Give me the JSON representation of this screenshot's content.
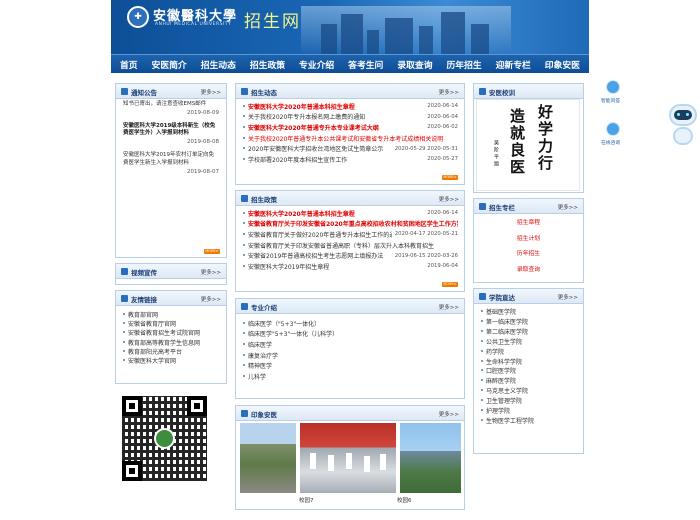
{
  "header": {
    "university_name": "安徽醫科大學",
    "university_en": "ANHUI MEDICAL UNIVERSITY",
    "site_title": "招生网"
  },
  "nav": {
    "items": [
      "首页",
      "安医简介",
      "招生动态",
      "招生政策",
      "专业介绍",
      "答考生问",
      "录取查询",
      "历年招生",
      "迎新专栏",
      "印象安医"
    ]
  },
  "notice": {
    "title": "通知公告",
    "more": "更多>>",
    "items": [
      {
        "text": "安徽医科大学2019年普通高考录取通知书已寄出，请注意查收EMS邮件",
        "date": "2019-08-09"
      },
      {
        "text": "安徽医科大学2019级本科新生（校免费医学生外）入学报到材料",
        "date": "2019-08-08"
      },
      {
        "text": "安徽医科大学2019年农村订单定向免费医学生新生入学报到材料",
        "date": "2019-08-07"
      }
    ],
    "more_tag": "MORE>"
  },
  "video": {
    "title": "视频宣传",
    "more": "更多>>"
  },
  "links": {
    "title": "友情链接",
    "more": "更多>>",
    "items": [
      "教育部官网",
      "安徽省教育厅官网",
      "安徽省教育招生考试院官网",
      "教育部高等教育学生信息网",
      "教育部阳光高考平台",
      "安徽医科大学官网"
    ]
  },
  "dynamics": {
    "title": "招生动态",
    "more": "更多>>",
    "rows": [
      {
        "text": "安徽医科大学2020年普通本科招生章程",
        "date": "2020-06-14",
        "style": "red bold"
      },
      {
        "text": "关于我校2020年专升本报名网上缴费的通知",
        "date": "2020-06-04",
        "style": ""
      },
      {
        "text": "安徽医科大学2020年普通专升本专业课考试大纲",
        "date": "2020-06-02",
        "style": "red bold"
      },
      {
        "text": "关于我校2020年普通专升本公共课考试和安徽省专升本考试成绩相关说明",
        "date": "",
        "style": "red"
      },
      {
        "text": "2020年安徽医科大学招收台湾地区免试生简章公示",
        "date": "2020-05-29  2020-05-31",
        "style": ""
      },
      {
        "text": "学校部署2020年度本科招生宣传工作",
        "date": "2020-05-27",
        "style": ""
      }
    ],
    "more_tag": "MORE>"
  },
  "policy": {
    "title": "招生政策",
    "more": "更多>>",
    "rows": [
      {
        "text": "安徽医科大学2020年普通本科招生章程",
        "date": "2020-06-14",
        "style": "red bold"
      },
      {
        "text": "安徽省教育厅关于印发安徽省2020年重点高校招收农村和贫困地区学生工作方案的通知",
        "date": "",
        "style": "red bold"
      },
      {
        "text": "安徽省教育厅关于做好2020年普通专升本招生工作的通知",
        "date": "2020-04-17  2020-05-21",
        "style": ""
      },
      {
        "text": "安徽省教育厅关于印发安徽省普通高职（专科）层次升入本科教育招生",
        "date": "",
        "style": ""
      },
      {
        "text": "安徽省2019年普通高校招生考生志愿网上填报办法",
        "date": "2019-06-15  2020-03-26",
        "style": ""
      },
      {
        "text": "安徽医科大学2019年招生章程",
        "date": "2019-06-04",
        "style": ""
      }
    ],
    "more_tag": "MORE>"
  },
  "majors": {
    "title": "专业介绍",
    "more": "更多>>",
    "items": [
      "临床医学（\"5+3\"一体化）",
      "临床医学\"5+3\"一体化（儿科学）",
      "临床医学",
      "康复治疗学",
      "精神医学",
      "儿科学"
    ]
  },
  "impression": {
    "title": "印象安医",
    "more": "更多>>",
    "captions": [
      "校园7",
      "校园6"
    ]
  },
  "campus": {
    "title": "安医校训",
    "calligraphy_cols": [
      "好学力行",
      "造就良医"
    ],
    "signature": "吴阶平题"
  },
  "zhuanlan": {
    "title": "招生专栏",
    "more": "更多>>",
    "items": [
      "招生章程",
      "招生计划",
      "历年招生",
      "录取查询"
    ]
  },
  "colleges": {
    "title": "学院直达",
    "more": "更多>>",
    "items": [
      "基础医学院",
      "第一临床医学院",
      "第二临床医学院",
      "公共卫生学院",
      "药学院",
      "生命科学学院",
      "口腔医学院",
      "麻醉医学院",
      "马克思主义学院",
      "卫生管理学院",
      "护理学院",
      "生物医学工程学院"
    ]
  },
  "float": {
    "labels": [
      "智能问答",
      "在线咨询"
    ]
  }
}
